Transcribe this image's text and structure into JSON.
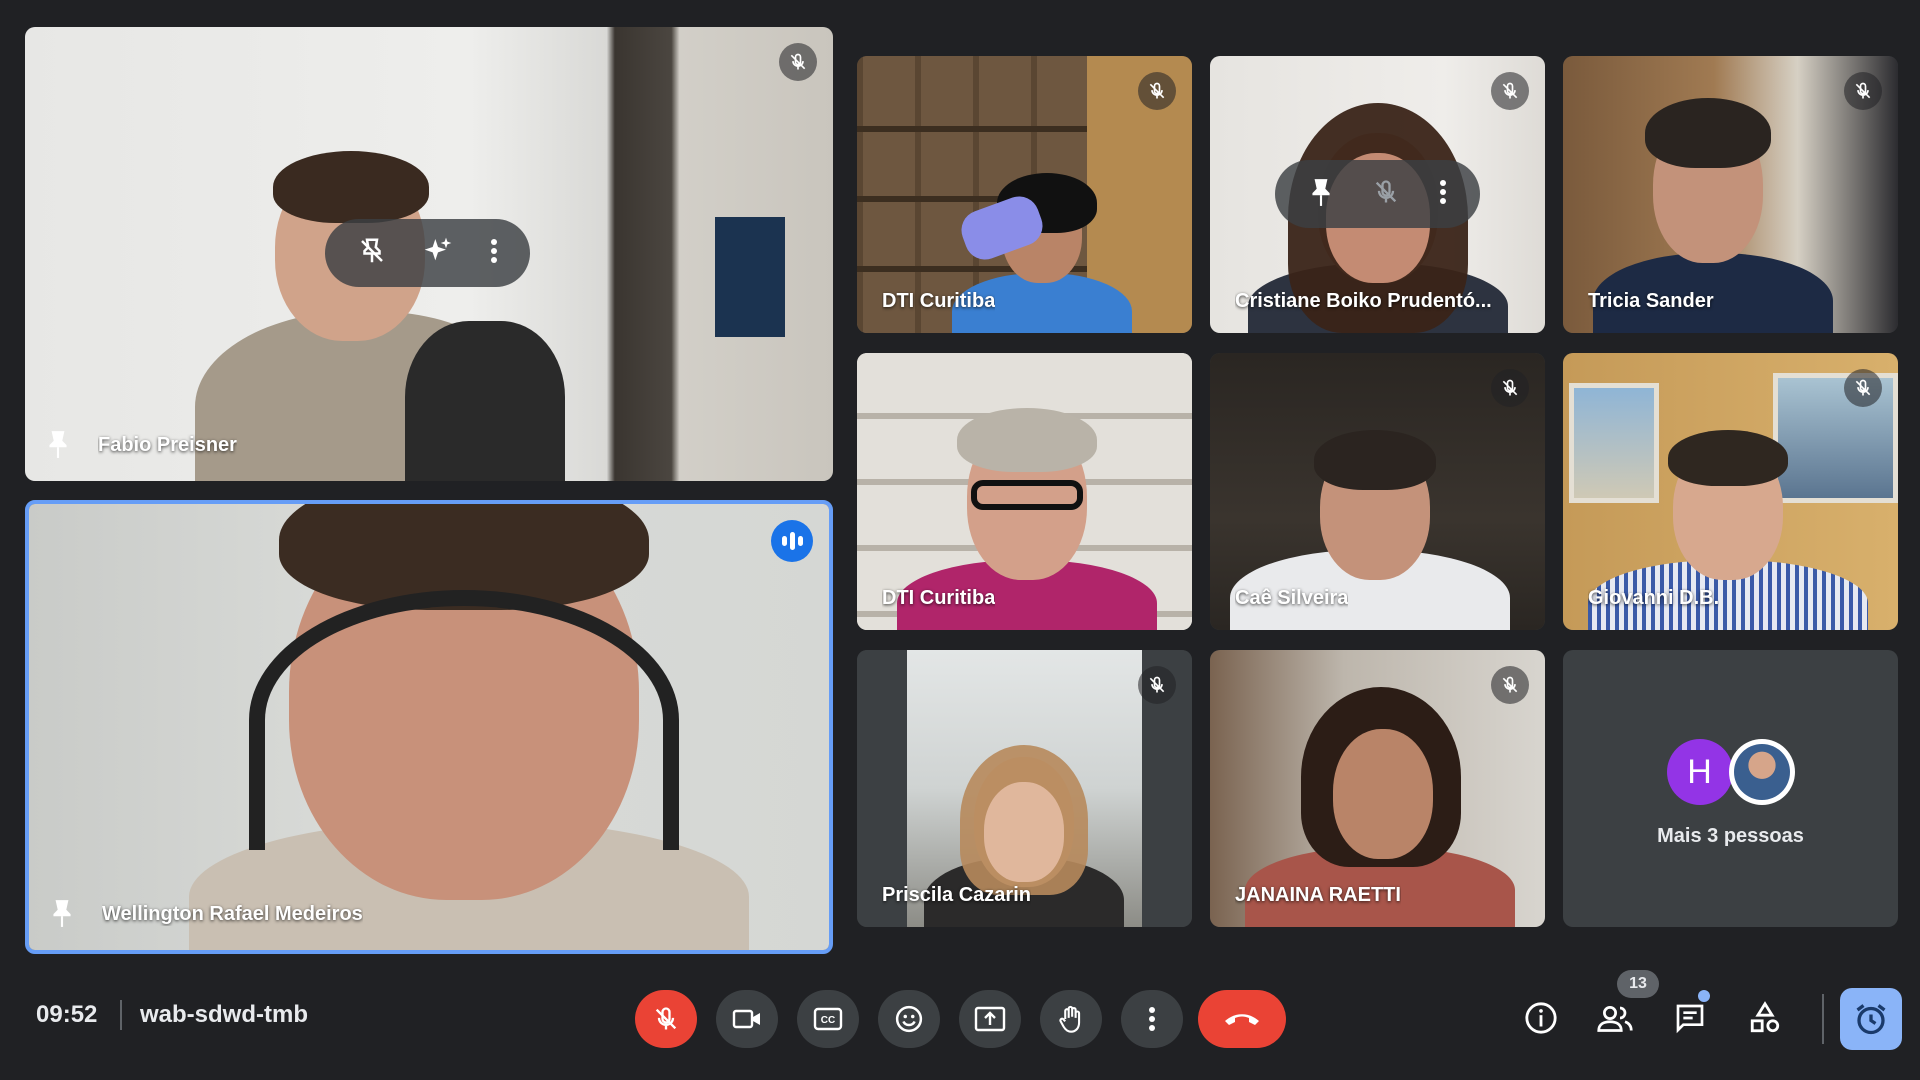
{
  "participants": {
    "pinned_top": {
      "name": "Fabio Preisner"
    },
    "pinned_main": {
      "name": "Wellington Rafael Medeiros"
    },
    "grid": [
      {
        "name": "DTI Curitiba"
      },
      {
        "name": "Cristiane Boiko Prudentó..."
      },
      {
        "name": "Tricia Sander"
      },
      {
        "name": "DTI Curitiba"
      },
      {
        "name": "Caê Silveira"
      },
      {
        "name": "Giovanni D.B."
      },
      {
        "name": "Priscila Cazarin"
      },
      {
        "name": "JANAINA RAETTI"
      }
    ],
    "more": {
      "avatar_letter": "H",
      "label": "Mais 3 pessoas"
    }
  },
  "bottom_bar": {
    "time": "09:52",
    "meeting_code": "wab-sdwd-tmb",
    "participant_count": "13"
  },
  "icons": {
    "mic": "mic-off-icon",
    "camera": "videocam-icon",
    "captions": "closed-captions-icon",
    "reactions": "emoji-icon",
    "present": "present-screen-icon",
    "raise_hand": "raise-hand-icon",
    "more": "more-vert-icon",
    "leave": "call-end-icon",
    "info": "info-icon",
    "people": "people-icon",
    "chat": "chat-icon",
    "activities": "activities-icon",
    "timer": "alarm-icon"
  },
  "colors": {
    "background": "#202124",
    "tile": "#3c4043",
    "danger": "#ea4335",
    "accent": "#8ab4f8",
    "speaking": "#1a73e8",
    "speaking_border": "#669df6",
    "avatar": "#9334e6"
  }
}
